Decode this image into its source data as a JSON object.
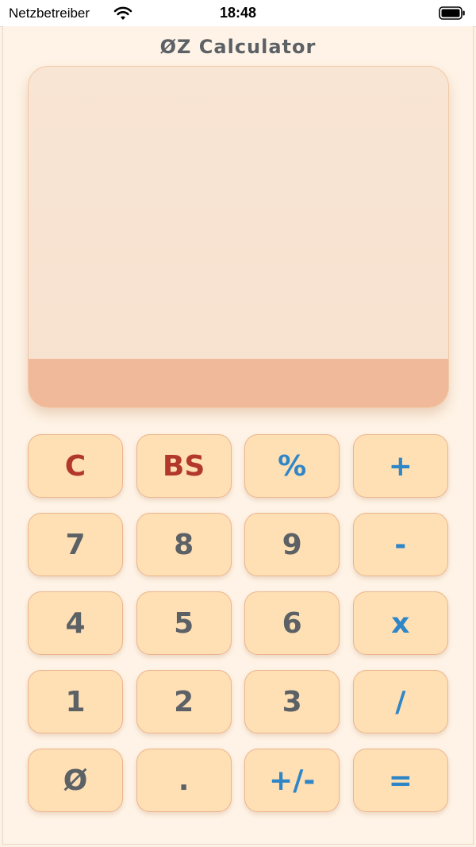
{
  "status_bar": {
    "carrier": "Netzbetreiber",
    "time": "18:48"
  },
  "app": {
    "title": "ØZ Calculator"
  },
  "display": {
    "expression": "",
    "result": ""
  },
  "keypad": {
    "keys": [
      {
        "label": "C",
        "name": "clear-button",
        "kind": "danger"
      },
      {
        "label": "BS",
        "name": "backspace-button",
        "kind": "danger"
      },
      {
        "label": "%",
        "name": "percent-button",
        "kind": "op"
      },
      {
        "label": "+",
        "name": "add-button",
        "kind": "op"
      },
      {
        "label": "7",
        "name": "digit-7-button",
        "kind": "num"
      },
      {
        "label": "8",
        "name": "digit-8-button",
        "kind": "num"
      },
      {
        "label": "9",
        "name": "digit-9-button",
        "kind": "num"
      },
      {
        "label": "-",
        "name": "subtract-button",
        "kind": "op"
      },
      {
        "label": "4",
        "name": "digit-4-button",
        "kind": "num"
      },
      {
        "label": "5",
        "name": "digit-5-button",
        "kind": "num"
      },
      {
        "label": "6",
        "name": "digit-6-button",
        "kind": "num"
      },
      {
        "label": "x",
        "name": "multiply-button",
        "kind": "op"
      },
      {
        "label": "1",
        "name": "digit-1-button",
        "kind": "num"
      },
      {
        "label": "2",
        "name": "digit-2-button",
        "kind": "num"
      },
      {
        "label": "3",
        "name": "digit-3-button",
        "kind": "num"
      },
      {
        "label": "/",
        "name": "divide-button",
        "kind": "op"
      },
      {
        "label": "Ø",
        "name": "digit-0-button",
        "kind": "num"
      },
      {
        "label": ".",
        "name": "decimal-button",
        "kind": "num"
      },
      {
        "label": "+/-",
        "name": "toggle-sign-button",
        "kind": "op"
      },
      {
        "label": "=",
        "name": "equals-button",
        "kind": "op"
      }
    ]
  },
  "colors": {
    "background": "#fef3e6",
    "key_fill": "#ffdfb4",
    "key_border": "#ecb58f",
    "display_fill": "#f9e5d4",
    "result_bar": "#efb99a",
    "digit_text": "#5c6166",
    "operator_text": "#2f86c7",
    "danger_text": "#b2392a"
  },
  "icons": {
    "wifi": "wifi-icon",
    "battery": "battery-icon"
  }
}
